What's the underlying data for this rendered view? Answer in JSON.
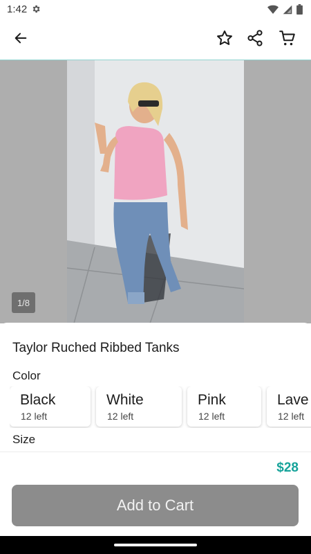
{
  "status_bar": {
    "time": "1:42",
    "icons": [
      "gear-icon",
      "wifi-icon",
      "signal-icon",
      "battery-icon"
    ]
  },
  "app_bar": {
    "icons": [
      "arrow-back-icon",
      "star-outline-icon",
      "share-icon",
      "cart-icon"
    ]
  },
  "gallery": {
    "counter": "1/8"
  },
  "product": {
    "title": "Taylor Ruched Ribbed Tanks",
    "color_label": "Color",
    "size_label": "Size",
    "colors": [
      {
        "name": "Black",
        "stock": "12 left"
      },
      {
        "name": "White",
        "stock": "12 left"
      },
      {
        "name": "Pink",
        "stock": "12 left"
      },
      {
        "name": "Lave",
        "stock": "12 left"
      }
    ],
    "price": "$28"
  },
  "actions": {
    "add_to_cart": "Add to Cart"
  },
  "colors": {
    "accent": "#16a39a",
    "button_disabled": "#8c8c8c",
    "gallery_bg": "#aeaeae"
  }
}
